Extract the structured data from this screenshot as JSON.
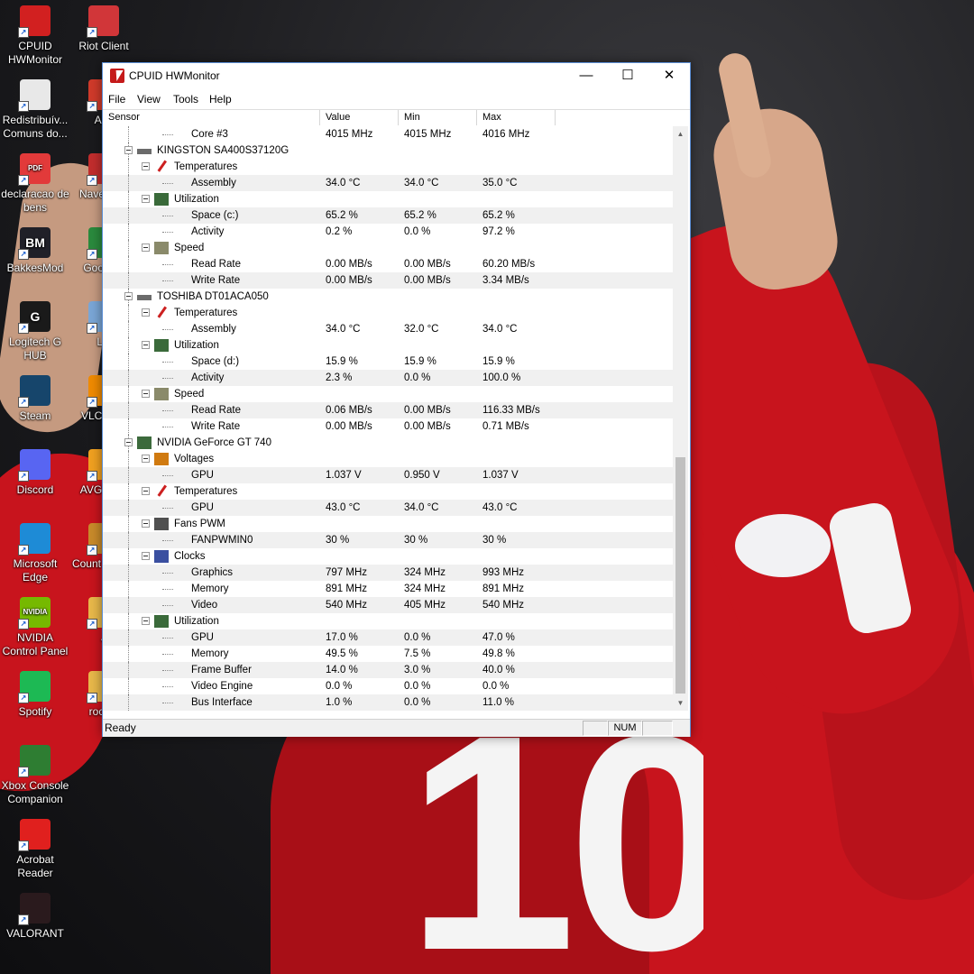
{
  "desktop": {
    "icons": [
      {
        "label": "CPUID HWMonitor",
        "icon": "hwmonitor-icon"
      },
      {
        "label": "Redistribuív... Comuns do...",
        "icon": "document-icon"
      },
      {
        "label": "declaracao de bens",
        "icon": "pdf-icon",
        "badge": "PDF"
      },
      {
        "label": "BakkesMod",
        "icon": "bakkesmod-icon",
        "badge": "BM"
      },
      {
        "label": "Logitech G HUB",
        "icon": "logitech-icon",
        "badge": "G"
      },
      {
        "label": "Steam",
        "icon": "steam-icon"
      },
      {
        "label": "Discord",
        "icon": "discord-icon"
      },
      {
        "label": "Microsoft Edge",
        "icon": "edge-icon"
      },
      {
        "label": "NVIDIA Control Panel",
        "icon": "nvidia-icon",
        "badge": "NVIDIA"
      },
      {
        "label": "Spotify",
        "icon": "spotify-icon"
      },
      {
        "label": "Xbox Console Companion",
        "icon": "xbox-icon"
      },
      {
        "label": "Acrobat Reader",
        "icon": "acrobat-icon"
      },
      {
        "label": "VALORANT",
        "icon": "valorant-icon"
      },
      {
        "label": "Riot Client",
        "icon": "riot-icon"
      },
      {
        "label": "Any",
        "icon": "app-icon"
      },
      {
        "label": "Nave Ope",
        "icon": "browser-icon"
      },
      {
        "label": "Goo Chr",
        "icon": "chrome-icon"
      },
      {
        "label": "Lix",
        "icon": "recycle-bin-icon"
      },
      {
        "label": "VLC r pla",
        "icon": "vlc-icon"
      },
      {
        "label": "AVG A FF",
        "icon": "avg-icon"
      },
      {
        "label": "Count Global",
        "icon": "csgo-icon"
      },
      {
        "label": "J",
        "icon": "folder-icon"
      },
      {
        "label": "rock e",
        "icon": "folder-icon"
      }
    ]
  },
  "wallpaper": {
    "shirt_number": "10"
  },
  "window": {
    "title": "CPUID HWMonitor",
    "controls": {
      "minimize": "—",
      "maximize": "☐",
      "close": "✕"
    },
    "menu": [
      "File",
      "View",
      "Tools",
      "Help"
    ],
    "columns": [
      "Sensor",
      "Value",
      "Min",
      "Max"
    ],
    "rows": [
      {
        "level": 4,
        "name": "Core #3",
        "value": "4015 MHz",
        "min": "4015 MHz",
        "max": "4016 MHz"
      },
      {
        "level": 1,
        "name": "KINGSTON SA400S37120G",
        "icon": "disk-icon"
      },
      {
        "level": 2,
        "name": "Temperatures",
        "icon": "thermometer-icon"
      },
      {
        "level": 3,
        "name": "Assembly",
        "value": "34.0 °C",
        "min": "34.0 °C",
        "max": "35.0 °C"
      },
      {
        "level": 2,
        "name": "Utilization",
        "icon": "utilization-icon"
      },
      {
        "level": 3,
        "name": "Space (c:)",
        "value": "65.2 %",
        "min": "65.2 %",
        "max": "65.2 %"
      },
      {
        "level": 3,
        "name": "Activity",
        "value": "0.2 %",
        "min": "0.0 %",
        "max": "97.2 %"
      },
      {
        "level": 2,
        "name": "Speed",
        "icon": "speed-gauge-icon"
      },
      {
        "level": 3,
        "name": "Read Rate",
        "value": "0.00 MB/s",
        "min": "0.00 MB/s",
        "max": "60.20 MB/s"
      },
      {
        "level": 3,
        "name": "Write Rate",
        "value": "0.00 MB/s",
        "min": "0.00 MB/s",
        "max": "3.34 MB/s"
      },
      {
        "level": 1,
        "name": "TOSHIBA DT01ACA050",
        "icon": "disk-icon"
      },
      {
        "level": 2,
        "name": "Temperatures",
        "icon": "thermometer-icon"
      },
      {
        "level": 3,
        "name": "Assembly",
        "value": "34.0 °C",
        "min": "32.0 °C",
        "max": "34.0 °C"
      },
      {
        "level": 2,
        "name": "Utilization",
        "icon": "utilization-icon"
      },
      {
        "level": 3,
        "name": "Space (d:)",
        "value": "15.9 %",
        "min": "15.9 %",
        "max": "15.9 %"
      },
      {
        "level": 3,
        "name": "Activity",
        "value": "2.3 %",
        "min": "0.0 %",
        "max": "100.0 %"
      },
      {
        "level": 2,
        "name": "Speed",
        "icon": "speed-gauge-icon"
      },
      {
        "level": 3,
        "name": "Read Rate",
        "value": "0.06 MB/s",
        "min": "0.00 MB/s",
        "max": "116.33 MB/s"
      },
      {
        "level": 3,
        "name": "Write Rate",
        "value": "0.00 MB/s",
        "min": "0.00 MB/s",
        "max": "0.71 MB/s"
      },
      {
        "level": 1,
        "name": "NVIDIA GeForce GT 740",
        "icon": "gpu-icon"
      },
      {
        "level": 2,
        "name": "Voltages",
        "icon": "voltage-icon"
      },
      {
        "level": 3,
        "name": "GPU",
        "value": "1.037 V",
        "min": "0.950 V",
        "max": "1.037 V"
      },
      {
        "level": 2,
        "name": "Temperatures",
        "icon": "thermometer-icon"
      },
      {
        "level": 3,
        "name": "GPU",
        "value": "43.0 °C",
        "min": "34.0 °C",
        "max": "43.0 °C"
      },
      {
        "level": 2,
        "name": "Fans PWM",
        "icon": "fan-icon"
      },
      {
        "level": 3,
        "name": "FANPWMIN0",
        "value": "30 %",
        "min": "30 %",
        "max": "30 %"
      },
      {
        "level": 2,
        "name": "Clocks",
        "icon": "clock-icon"
      },
      {
        "level": 3,
        "name": "Graphics",
        "value": "797 MHz",
        "min": "324 MHz",
        "max": "993 MHz"
      },
      {
        "level": 3,
        "name": "Memory",
        "value": "891 MHz",
        "min": "324 MHz",
        "max": "891 MHz"
      },
      {
        "level": 3,
        "name": "Video",
        "value": "540 MHz",
        "min": "405 MHz",
        "max": "540 MHz"
      },
      {
        "level": 2,
        "name": "Utilization",
        "icon": "utilization-icon"
      },
      {
        "level": 3,
        "name": "GPU",
        "value": "17.0 %",
        "min": "0.0 %",
        "max": "47.0 %"
      },
      {
        "level": 3,
        "name": "Memory",
        "value": "49.5 %",
        "min": "7.5 %",
        "max": "49.8 %"
      },
      {
        "level": 3,
        "name": "Frame Buffer",
        "value": "14.0 %",
        "min": "3.0 %",
        "max": "40.0 %"
      },
      {
        "level": 3,
        "name": "Video Engine",
        "value": "0.0 %",
        "min": "0.0 %",
        "max": "0.0 %"
      },
      {
        "level": 3,
        "name": "Bus Interface",
        "value": "1.0 %",
        "min": "0.0 %",
        "max": "11.0 %"
      }
    ],
    "status": {
      "text": "Ready",
      "num": "NUM"
    }
  },
  "colors": {
    "accent": "#c51a1a",
    "row_alt": "#f0f0f0",
    "window_border": "#5c8fd6"
  }
}
